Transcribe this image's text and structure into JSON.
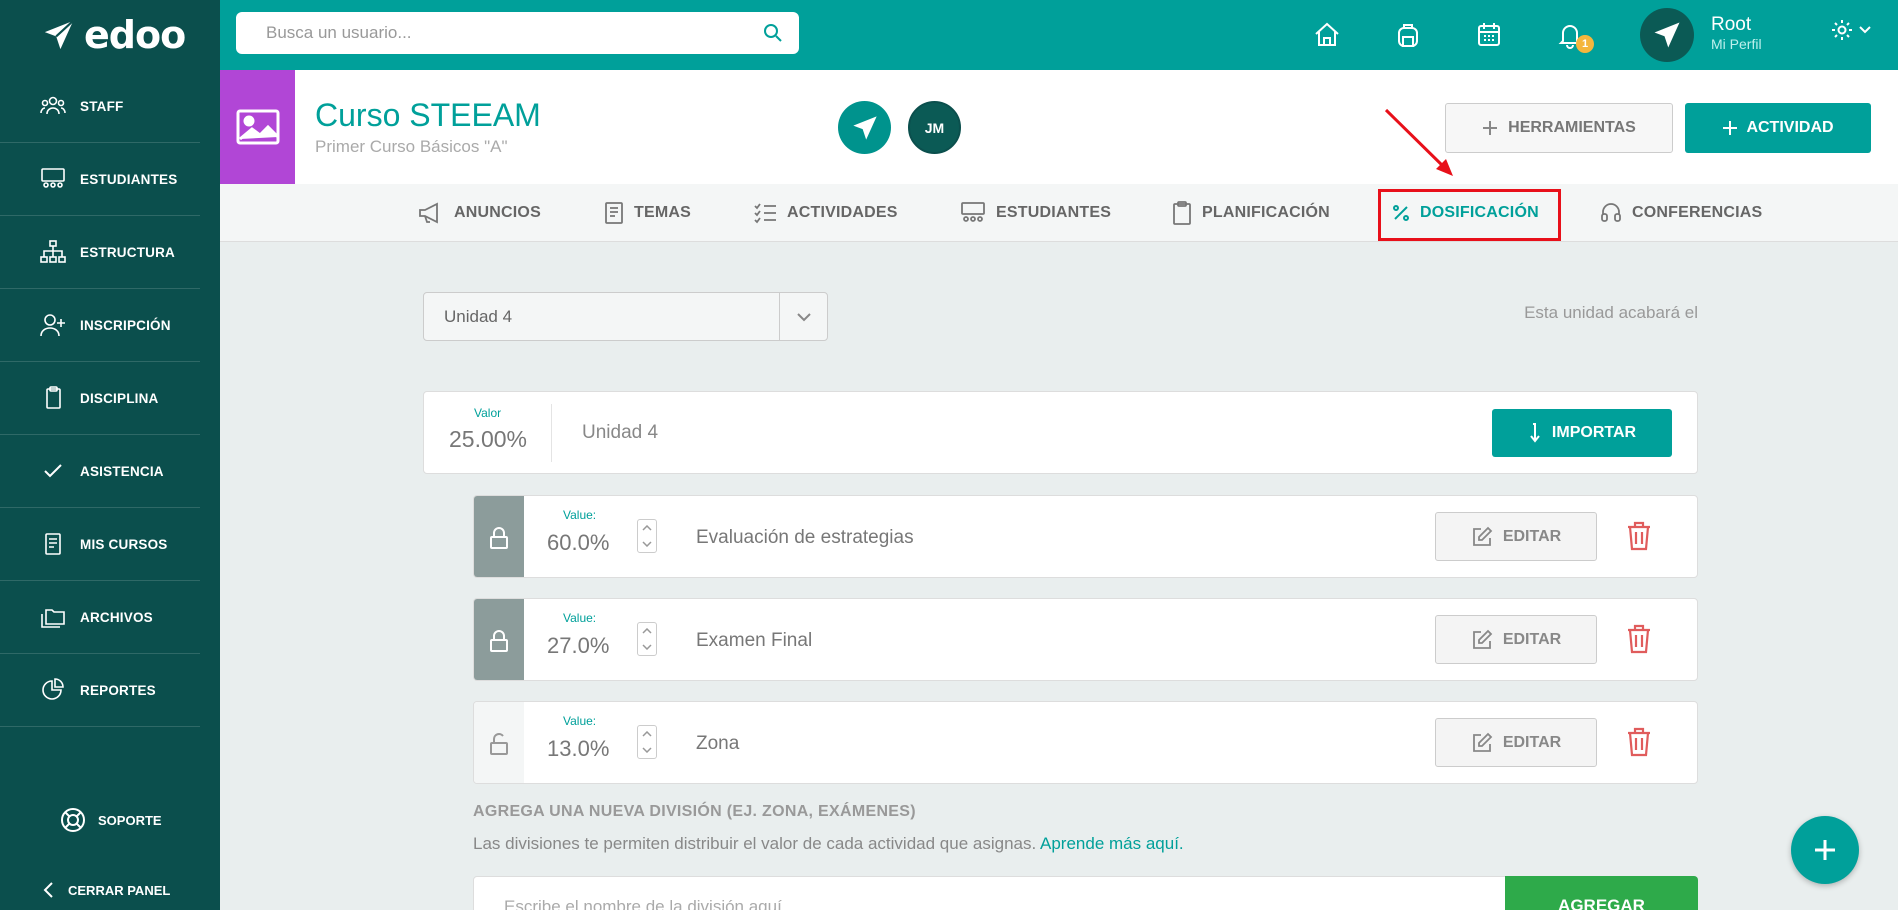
{
  "app": {
    "logo_text": "edoo"
  },
  "sidebar": {
    "items": [
      {
        "label": "STAFF",
        "icon": "staff-icon"
      },
      {
        "label": "ESTUDIANTES",
        "icon": "students-icon"
      },
      {
        "label": "ESTRUCTURA",
        "icon": "structure-icon"
      },
      {
        "label": "INSCRIPCIÓN",
        "icon": "add-user-icon"
      },
      {
        "label": "DISCIPLINA",
        "icon": "clipboard-icon"
      },
      {
        "label": "ASISTENCIA",
        "icon": "check-icon"
      },
      {
        "label": "MIS CURSOS",
        "icon": "book-icon"
      },
      {
        "label": "ARCHIVOS",
        "icon": "folders-icon"
      },
      {
        "label": "REPORTES",
        "icon": "pie-chart-icon"
      }
    ],
    "support_label": "SOPORTE",
    "close_panel_label": "CERRAR PANEL"
  },
  "topbar": {
    "search_placeholder": "Busca un usuario...",
    "notification_count": "1",
    "profile_name": "Root",
    "profile_sub": "Mi Perfil"
  },
  "course": {
    "title": "Curso STEEAM",
    "subtitle": "Primer Curso Básicos \"A\"",
    "member_initials": "JM",
    "tools_label": "HERRAMIENTAS",
    "activity_label": "ACTIVIDAD"
  },
  "tabs": [
    {
      "label": "ANUNCIOS",
      "icon": "megaphone-icon",
      "active": false
    },
    {
      "label": "TEMAS",
      "icon": "book-icon",
      "active": false
    },
    {
      "label": "ACTIVIDADES",
      "icon": "list-check-icon",
      "active": false
    },
    {
      "label": "ESTUDIANTES",
      "icon": "students-icon",
      "active": false
    },
    {
      "label": "PLANIFICACIÓN",
      "icon": "clipboard-icon",
      "active": false
    },
    {
      "label": "DOSIFICACIÓN",
      "icon": "percent-icon",
      "active": true
    },
    {
      "label": "CONFERENCIAS",
      "icon": "headset-icon",
      "active": false
    }
  ],
  "unit_select": {
    "value": "Unidad 4"
  },
  "unit_end_text": "Esta unidad acabará el",
  "unit_card": {
    "valor_label": "Valor",
    "valor_value": "25.00%",
    "name": "Unidad 4",
    "import_label": "IMPORTAR"
  },
  "divisions": [
    {
      "label": "Value:",
      "value": "60.0%",
      "name": "Evaluación de estrategias",
      "locked": true,
      "edit_label": "EDITAR"
    },
    {
      "label": "Value:",
      "value": "27.0%",
      "name": "Examen Final",
      "locked": true,
      "edit_label": "EDITAR"
    },
    {
      "label": "Value:",
      "value": "13.0%",
      "name": "Zona",
      "locked": false,
      "edit_label": "EDITAR"
    }
  ],
  "new_division": {
    "title": "AGREGA UNA NUEVA DIVISIÓN (EJ. ZONA, EXÁMENES)",
    "help": "Las divisiones te permiten distribuir el valor de cada actividad que asignas.",
    "help_link": "Aprende más aquí.",
    "input_placeholder": "Escribe el nombre de la división aquí",
    "add_label": "AGREGAR"
  },
  "colors": {
    "brand": "#00a09a",
    "sidebar": "#0b4f4d",
    "course_accent": "#b146d6",
    "highlight": "#e8101a",
    "delete": "#e05c5c",
    "add": "#2eaa4a"
  }
}
